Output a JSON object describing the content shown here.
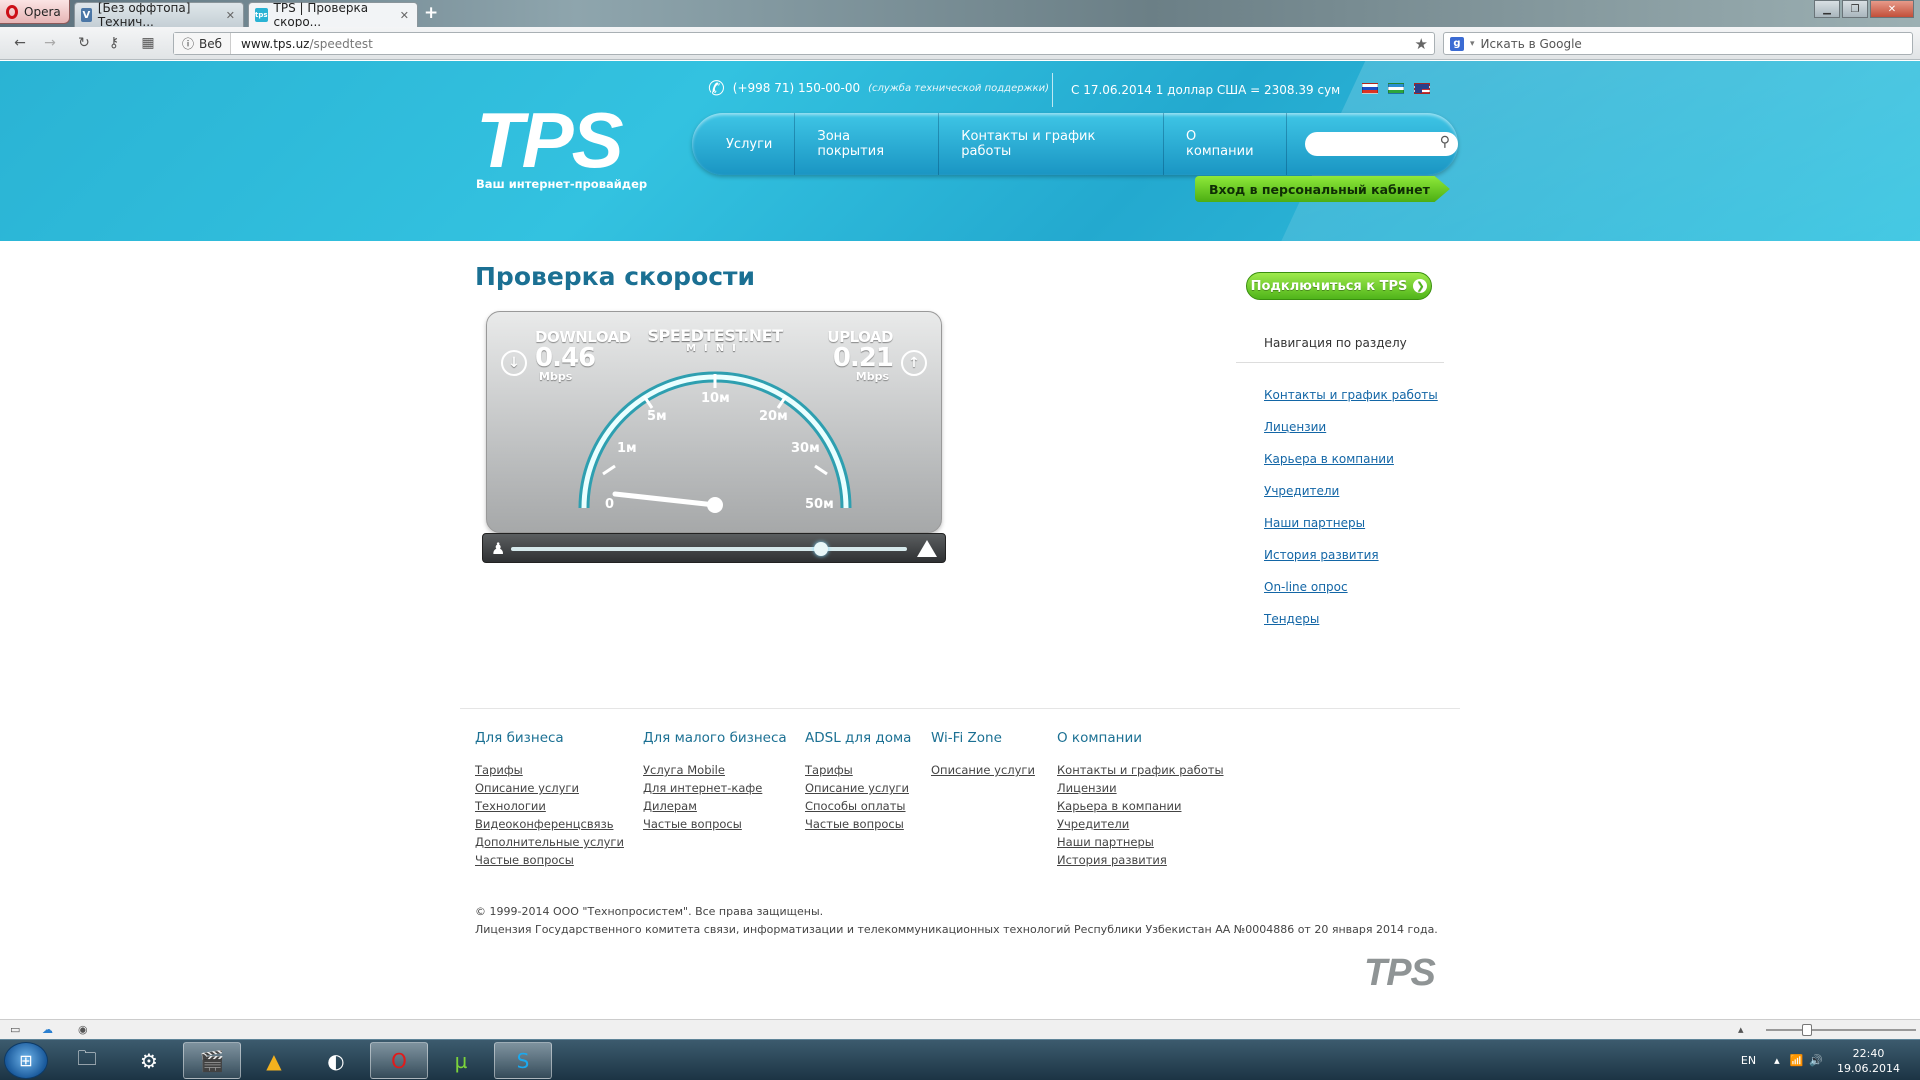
{
  "browser": {
    "menu_label": "Opera",
    "tabs": [
      {
        "label": "[Без оффтопа] Технич...",
        "favicon": "vk-icon"
      },
      {
        "label": "TPS | Проверка скоро...",
        "favicon": "tps-icon"
      }
    ],
    "new_tab": "+",
    "web_label": "Веб",
    "url_domain": "www.tps.uz",
    "url_path": "/speedtest",
    "search_placeholder": "Искать в Google"
  },
  "header": {
    "logo": "TPS",
    "slogan": "Ваш интернет-провайдер",
    "phone": "(+998 71) 150-00-00",
    "phone_note": "(служба технической поддержки)",
    "rate": "С 17.06.2014 1 доллар США = 2308.39 сум",
    "menu": [
      "Услуги",
      "Зона покрытия",
      "Контакты и график работы",
      "О компании"
    ],
    "cabinet": "Вход в персональный кабинет"
  },
  "page": {
    "title": "Проверка скорости",
    "connect": "Подключиться к TPS",
    "nav_title": "Навигация по разделу",
    "nav_links": [
      "Контакты и график работы",
      "Лицензии",
      "Карьера в компании",
      "Учредители",
      "Наши партнеры",
      "История развития",
      "On-line опрос",
      "Тендеры"
    ]
  },
  "speedtest": {
    "brand": "SPEEDTEST.NET",
    "brand_sub": "MINI",
    "download_label": "DOWNLOAD",
    "download_value": "0.46",
    "upload_label": "UPLOAD",
    "upload_value": "0.21",
    "unit": "Mbps",
    "scale": [
      "0",
      "1м",
      "5м",
      "10м",
      "20м",
      "30м",
      "50м"
    ]
  },
  "footer": {
    "columns": [
      {
        "title": "Для бизнеса",
        "links": [
          "Тарифы",
          "Описание услуги",
          "Технологии",
          "Видеоконференцсвязь",
          "Дополнительные услуги",
          "Частые вопросы"
        ]
      },
      {
        "title": "Для малого бизнеса",
        "links": [
          "Услуга Mobile",
          "Для интернет-кафе",
          "Дилерам",
          "Частые вопросы"
        ]
      },
      {
        "title": "ADSL для дома",
        "links": [
          "Тарифы",
          "Описание услуги",
          "Способы оплаты",
          "Частые вопросы"
        ]
      },
      {
        "title": "Wi-Fi Zone",
        "links": [
          "Описание услуги"
        ]
      },
      {
        "title": "О компании",
        "links": [
          "Контакты и график работы",
          "Лицензии",
          "Карьера в компании",
          "Учредители",
          "Наши партнеры",
          "История развития"
        ]
      }
    ],
    "copyright": "© 1999-2014 ООО \"Технопросистем\". Все права защищены.",
    "license": "Лицензия Государственного комитета связи, информатизации и телекоммуникационных технологий Республики Узбекистан АА №0004886 от 20 января 2014 года.",
    "logo": "TPS"
  },
  "taskbar": {
    "apps": [
      "explorer-icon",
      "steam-icon",
      "media-player-icon",
      "aimp-icon",
      "cinema4d-icon",
      "opera-icon",
      "utorrent-icon",
      "skype-icon"
    ],
    "lang": "EN",
    "time": "22:40",
    "date": "19.06.2014"
  }
}
